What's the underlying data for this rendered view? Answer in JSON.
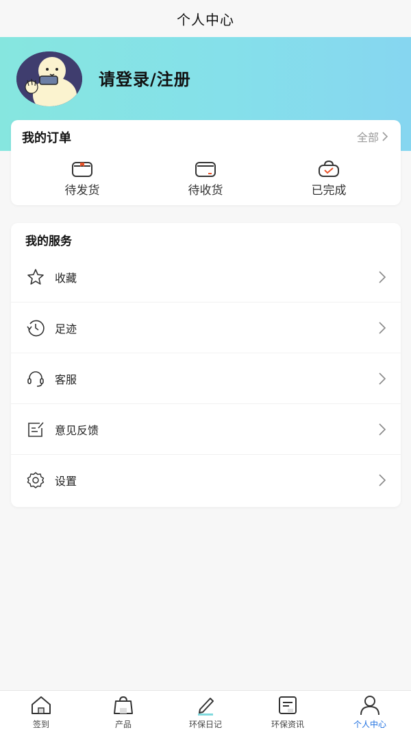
{
  "header": {
    "title": "个人中心"
  },
  "profile": {
    "login_label": "请登录/注册"
  },
  "orders": {
    "title": "我的订单",
    "all_label": "全部",
    "items": [
      {
        "label": "待发货",
        "icon": "box-pending-icon"
      },
      {
        "label": "待收货",
        "icon": "box-receive-icon"
      },
      {
        "label": "已完成",
        "icon": "bag-check-icon"
      }
    ]
  },
  "services": {
    "title": "我的服务",
    "items": [
      {
        "label": "收藏",
        "icon": "star-icon"
      },
      {
        "label": "足迹",
        "icon": "clock-icon"
      },
      {
        "label": "客服",
        "icon": "headset-icon"
      },
      {
        "label": "意见反馈",
        "icon": "feedback-edit-icon"
      },
      {
        "label": "设置",
        "icon": "gear-icon"
      }
    ]
  },
  "tabbar": {
    "items": [
      {
        "label": "签到",
        "icon": "home-icon"
      },
      {
        "label": "产品",
        "icon": "shopping-bag-icon"
      },
      {
        "label": "环保日记",
        "icon": "pencil-icon"
      },
      {
        "label": "环保资讯",
        "icon": "news-icon"
      },
      {
        "label": "个人中心",
        "icon": "person-icon",
        "active": true
      }
    ]
  },
  "colors": {
    "hero_gradient_start": "#86e6df",
    "hero_gradient_end": "#86d6f0",
    "active_tab": "#1d6fe0",
    "muted_text": "#9a9a9a"
  }
}
